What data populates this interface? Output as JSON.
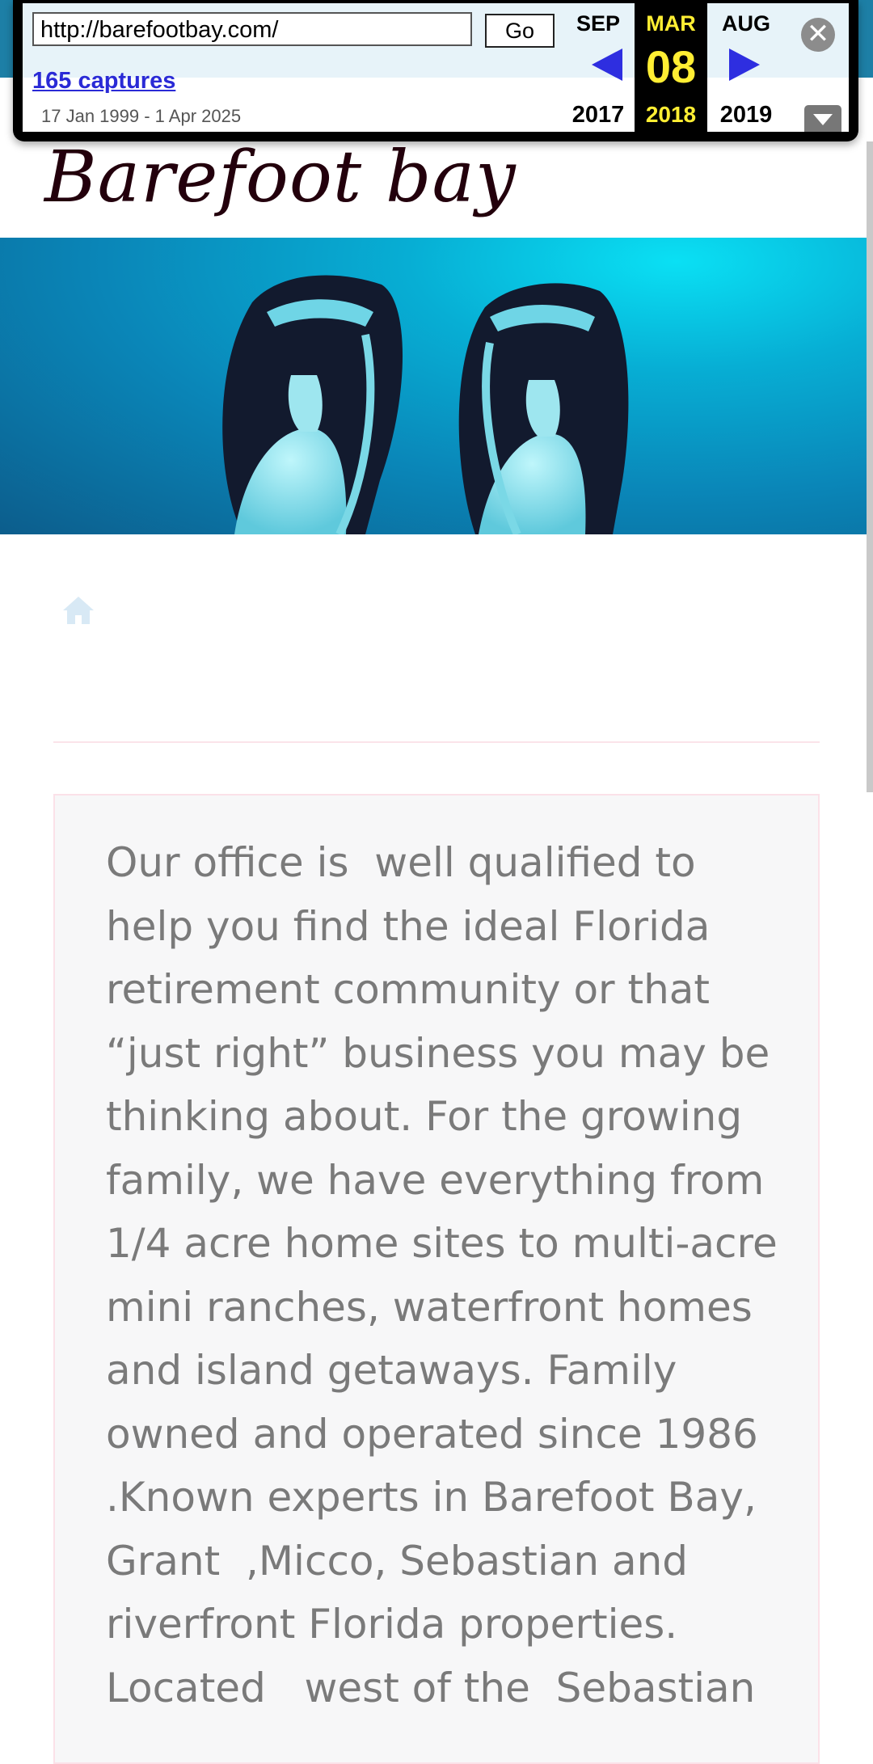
{
  "wayback": {
    "url": "http://barefootbay.com/",
    "go_label": "Go",
    "captures_label": "165 captures",
    "date_range": "17 Jan 1999 - 1 Apr 2025",
    "prev_month": "SEP",
    "prev_year": "2017",
    "current_month": "MAR",
    "current_day": "08",
    "current_year": "2018",
    "next_month": "AUG",
    "next_year": "2019",
    "close_icon": "close-icon",
    "expand_icon": "chevron-down-icon",
    "accent_color": "#2e2ee0",
    "highlight_color": "#ffee33"
  },
  "site": {
    "title": "Barefoot bay",
    "hero_image": "snorkel-fins-underwater",
    "home_icon": "home-icon"
  },
  "content": {
    "paragraph": "Our office is  well qualified to help you find the ideal Florida  retirement community or that “just right” business you may be thinking about. For the growing family, we have everything from 1/4 acre home sites to multi-acre mini ranches, waterfront homes and island getaways. Family owned and operated since 1986 .Known experts in Barefoot Bay, Grant  ,Micco, Sebastian and riverfront Florida properties. Located   west of the  Sebastian"
  }
}
